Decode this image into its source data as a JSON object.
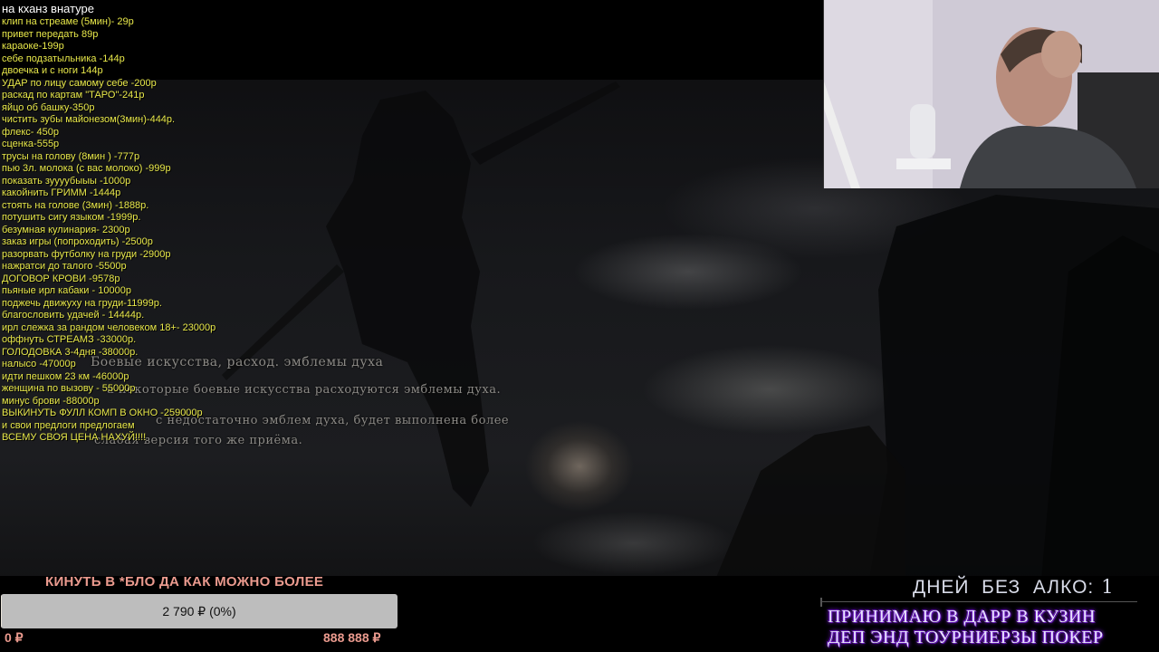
{
  "price_list": {
    "title": "на кханз внатуре",
    "items": [
      "клип на стреаме (5мин)- 29р",
      "привет передать 89р",
      "караоке-199р",
      "себе подзатыльника -144р",
      "двоечка и с ноги 144р",
      "УДАР по лицу самому себе -200р",
      "раскад по картам \"ТАРО\"-241р",
      "яйцо об башку-350р",
      "чистить зубы майонезом(3мин)-444р.",
      "флекс- 450р",
      "сценка-555р",
      "трусы на голову (8мин ) -777р",
      "пью 3л. молока (с вас молоко) -999р",
      "показать зуууубыыы -1000р",
      "какойнить ГРИММ -1444р",
      "стоять на голове (3мин) -1888р.",
      "потушить сигу языком -1999р.",
      "безумная кулинария- 2300р",
      "заказ игры (попроходить) -2500р",
      "разорвать футболку на груди -2900р",
      "нажратси до талого -5500р",
      "ДОГОВОР КРОВИ -9578р",
      "пьяные ирл кабаки - 10000р",
      "поджечь движуху на груди-11999р.",
      "благословить удачей - 14444р.",
      "ирл слежка за рандом человеком 18+- 23000р",
      "оффнуть СТРЕАМЗ -33000р.",
      "ГОЛОДОВКА 3-4дня -38000р.",
      "налысо -47000р",
      "идти пешком 23 км -46000р",
      "женщина по вызову - 55000р",
      "минус брови -88000р",
      "ВЫКИНУТЬ ФУЛЛ КОМП В ОКНО -259000р",
      "и свои предлоги предлогаем",
      "ВСЕМУ СВОЯ ЦЕНА НАХУЙ!!!!"
    ]
  },
  "tutorial": {
    "title": "Боевые искусства, расход. эмблемы духа",
    "lines": [
      "а некоторые боевые искусства расходуются эмблемы духа.",
      "с недостаточно эмблем духа, будет выполнена более",
      "слабая версия того же приёма."
    ]
  },
  "donation": {
    "title": "КИНУТЬ В *БЛО ДА КАК МОЖНО БОЛЕЕ",
    "current": "2 790 ₽ (0%)",
    "progress_fraction": 0.003,
    "min": "0 ₽",
    "max": "888 888 ₽"
  },
  "counter": {
    "label": "ДНЕЙ  БЕЗ  АЛКО:",
    "value": "1"
  },
  "promo": {
    "line1": "ПРИНИМАЮ В ДАРР В КУЗИН",
    "line2": "ДЕП ЭНД ТОУРНИЕРЗЫ ПОКЕР"
  },
  "colors": {
    "price_text": "#e8e84a",
    "donate_accent": "#ea9a8e",
    "promo_glow": "#7a20d6"
  }
}
